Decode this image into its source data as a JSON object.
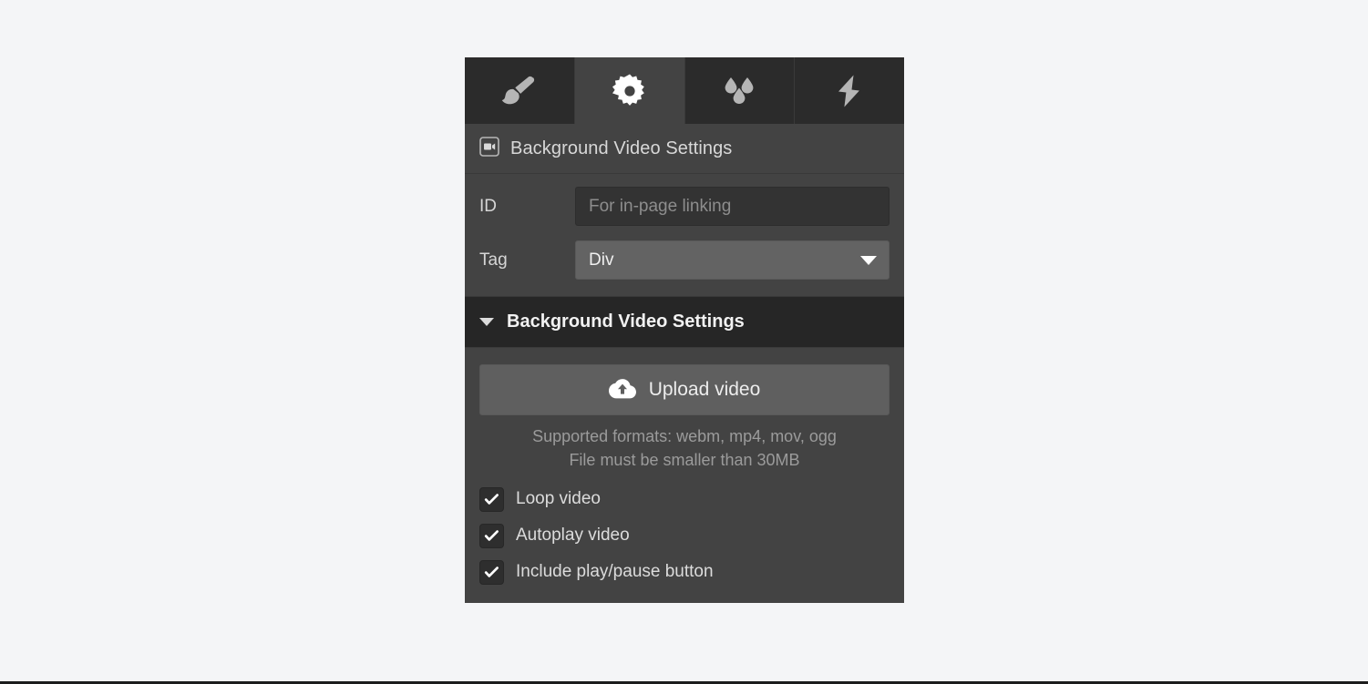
{
  "panel": {
    "tabs": [
      {
        "name": "style-tab",
        "icon": "paintbrush-icon",
        "active": false
      },
      {
        "name": "settings-tab",
        "icon": "gear-icon",
        "active": true
      },
      {
        "name": "effects-tab",
        "icon": "water-drops-icon",
        "active": false
      },
      {
        "name": "actions-tab",
        "icon": "lightning-bolt-icon",
        "active": false
      }
    ],
    "header": {
      "icon": "video-camera-icon",
      "title": "Background Video Settings"
    },
    "fields": {
      "id": {
        "label": "ID",
        "value": "",
        "placeholder": "For in-page linking"
      },
      "tag": {
        "label": "Tag",
        "value": "Div",
        "caret_icon": "chevron-down-icon"
      }
    },
    "section": {
      "caret_icon": "triangle-down-icon",
      "title": "Background Video Settings",
      "upload": {
        "icon": "cloud-upload-icon",
        "label": "Upload video"
      },
      "hint_line_1": "Supported formats: webm, mp4, mov, ogg",
      "hint_line_2": "File must be smaller than 30MB",
      "checkboxes": [
        {
          "label": "Loop video",
          "checked": true
        },
        {
          "label": "Autoplay video",
          "checked": true
        },
        {
          "label": "Include play/pause button",
          "checked": true
        }
      ]
    }
  },
  "colors": {
    "page_background": "#f4f5f7",
    "panel_background": "#434343",
    "tabbar_background": "#2b2b2b",
    "section_header_background": "#262626",
    "input_background": "#333333",
    "select_background": "#636363",
    "button_background": "#5f5f5f",
    "text_primary": "#e6e6e6",
    "text_muted": "#9b9b9b"
  }
}
